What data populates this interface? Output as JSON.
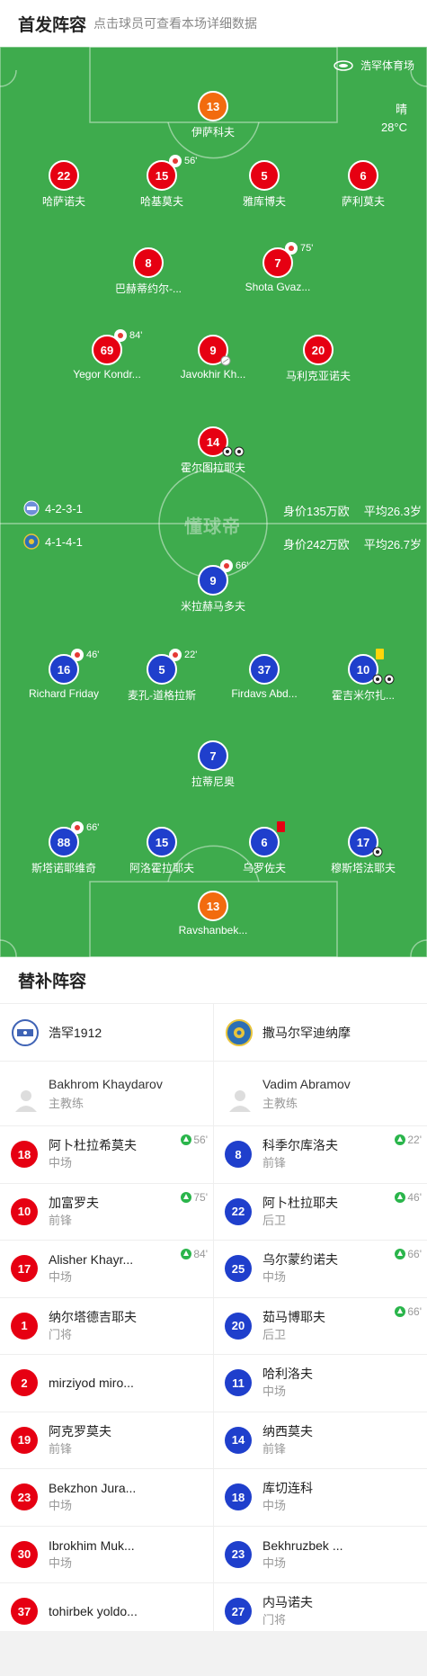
{
  "header": {
    "title": "首发阵容",
    "subtitle": "点击球员可查看本场详细数据"
  },
  "pitch": {
    "stadium": "浩罕体育场",
    "weather": "晴",
    "temperature": "28°C",
    "watermark": "懂球帝",
    "home_info": {
      "formation": "4-2-3-1",
      "value": "身价135万欧",
      "age": "平均26.3岁"
    },
    "away_info": {
      "formation": "4-1-4-1",
      "value": "身价242万欧",
      "age": "平均26.7岁"
    },
    "home_players": [
      {
        "num": "13",
        "name": "伊萨科夫",
        "gk": true
      },
      {
        "num": "22",
        "name": "哈萨诺夫"
      },
      {
        "num": "15",
        "name": "哈基莫夫",
        "sub": "56'"
      },
      {
        "num": "5",
        "name": "雅库博夫"
      },
      {
        "num": "6",
        "name": "萨利莫夫"
      },
      {
        "num": "8",
        "name": "巴赫蒂约尔-..."
      },
      {
        "num": "7",
        "name": "Shota Gvaz...",
        "sub": "75'"
      },
      {
        "num": "69",
        "name": "Yegor Kondr...",
        "sub": "84'"
      },
      {
        "num": "9",
        "name": "Javokhir Kh..."
      },
      {
        "num": "20",
        "name": "马利克亚诺夫"
      },
      {
        "num": "14",
        "name": "霍尔图拉耶夫",
        "goals": 2
      }
    ],
    "away_players": [
      {
        "num": "9",
        "name": "米拉赫马多夫",
        "sub": "66'"
      },
      {
        "num": "16",
        "name": "Richard Friday",
        "sub": "46'"
      },
      {
        "num": "5",
        "name": "麦孔-道格拉斯",
        "sub": "22'"
      },
      {
        "num": "37",
        "name": "Firdavs Abd..."
      },
      {
        "num": "10",
        "name": "霍吉米尔扎...",
        "goals": 2,
        "yellow": true
      },
      {
        "num": "7",
        "name": "拉蒂尼奥"
      },
      {
        "num": "88",
        "name": "斯塔诺耶维奇",
        "sub": "66'"
      },
      {
        "num": "15",
        "name": "阿洛霍拉耶夫"
      },
      {
        "num": "6",
        "name": "乌罗佐夫",
        "red": true
      },
      {
        "num": "17",
        "name": "穆斯塔法耶夫",
        "goals": 1
      },
      {
        "num": "13",
        "name": "Ravshanbek...",
        "gk": true
      }
    ]
  },
  "bench": {
    "title": "替补阵容",
    "home": {
      "team": "浩罕1912",
      "coach": {
        "name": "Bakhrom Khaydarov",
        "role": "主教练"
      },
      "players": [
        {
          "num": "18",
          "name": "阿卜杜拉希莫夫",
          "pos": "中场",
          "in": "56'"
        },
        {
          "num": "10",
          "name": "加富罗夫",
          "pos": "前锋",
          "in": "75'"
        },
        {
          "num": "17",
          "name": "Alisher Khayr...",
          "pos": "中场",
          "in": "84'"
        },
        {
          "num": "1",
          "name": "纳尔塔德吉耶夫",
          "pos": "门将"
        },
        {
          "num": "2",
          "name": "mirziyod miro...",
          "pos": ""
        },
        {
          "num": "19",
          "name": "阿克罗莫夫",
          "pos": "前锋"
        },
        {
          "num": "23",
          "name": "Bekzhon Jura...",
          "pos": "中场"
        },
        {
          "num": "30",
          "name": "Ibrokhim Muk...",
          "pos": "中场"
        },
        {
          "num": "37",
          "name": "tohirbek yoldo...",
          "pos": ""
        }
      ]
    },
    "away": {
      "team": "撒马尔罕迪纳摩",
      "coach": {
        "name": "Vadim Abramov",
        "role": "主教练"
      },
      "players": [
        {
          "num": "8",
          "name": "科季尔库洛夫",
          "pos": "前锋",
          "in": "22'"
        },
        {
          "num": "22",
          "name": "阿卜杜拉耶夫",
          "pos": "后卫",
          "in": "46'"
        },
        {
          "num": "25",
          "name": "乌尔蒙约诺夫",
          "pos": "中场",
          "in": "66'"
        },
        {
          "num": "20",
          "name": "茹马博耶夫",
          "pos": "后卫",
          "in": "66'"
        },
        {
          "num": "11",
          "name": "哈利洛夫",
          "pos": "中场"
        },
        {
          "num": "14",
          "name": "纳西莫夫",
          "pos": "前锋"
        },
        {
          "num": "18",
          "name": "库切连科",
          "pos": "中场"
        },
        {
          "num": "23",
          "name": "Bekhruzbek ...",
          "pos": "中场"
        },
        {
          "num": "27",
          "name": "内马诺夫",
          "pos": "门将"
        }
      ]
    }
  },
  "colors": {
    "pitch": "#3eab4d",
    "home": "#e60012",
    "away": "#1f3fcc",
    "keeper": "#f26b0f"
  }
}
